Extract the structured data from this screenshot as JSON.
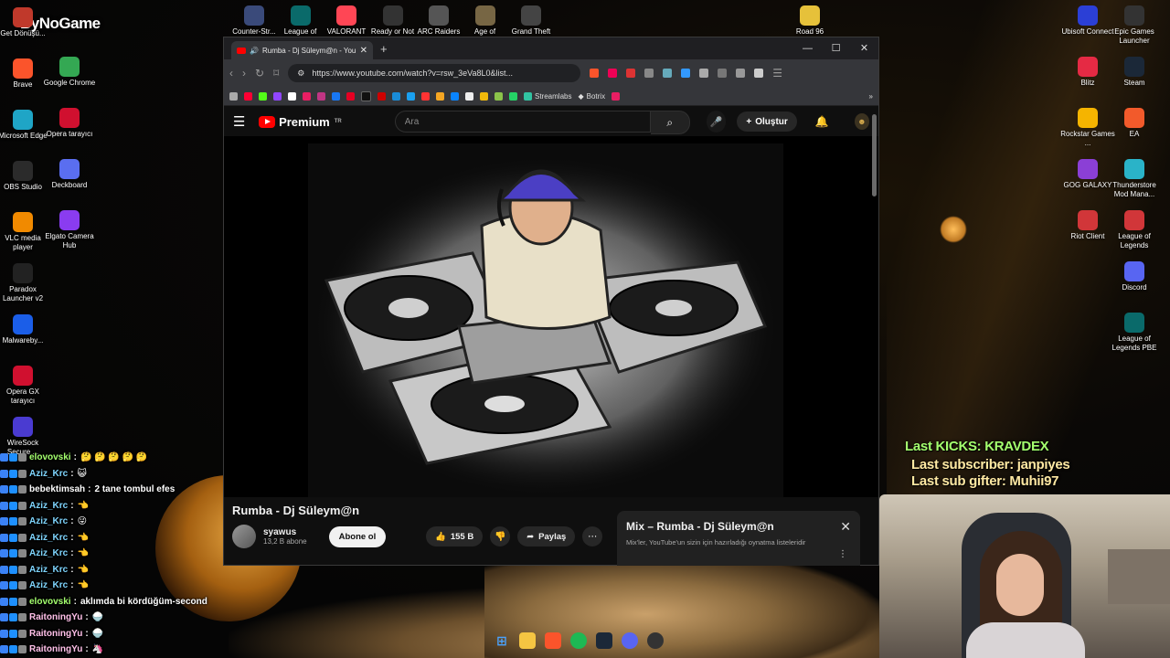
{
  "wallpaper": {
    "logo_text": "ByNoGame"
  },
  "desktop_left": [
    {
      "label": "Get Dönüşü...",
      "icon": "game-icon",
      "color": "#c0392b"
    },
    {
      "label": "Brave",
      "icon": "brave-icon",
      "color": "#fb542b"
    },
    {
      "label": "Microsoft Edge",
      "icon": "edge-icon",
      "color": "#1fa5c6"
    },
    {
      "label": "OBS Studio",
      "icon": "obs-icon",
      "color": "#2b2b2b"
    },
    {
      "label": "VLC media player",
      "icon": "vlc-icon",
      "color": "#f18a00"
    },
    {
      "label": "Paradox Launcher v2",
      "icon": "paradox-icon",
      "color": "#222"
    },
    {
      "label": "Malwareby...",
      "icon": "malwarebytes-icon",
      "color": "#1b5ee8"
    },
    {
      "label": "Opera GX tarayıcı",
      "icon": "operagx-icon",
      "color": "#d0102f"
    },
    {
      "label": "WireSock Secure ...",
      "icon": "wiresock-icon",
      "color": "#4a3bd1"
    }
  ],
  "desktop_left2": [
    {
      "label": "Google Chrome",
      "icon": "chrome-icon",
      "color": "#34a853"
    },
    {
      "label": "Opera tarayıcı",
      "icon": "opera-icon",
      "color": "#d0102f"
    },
    {
      "label": "Deckboard",
      "icon": "deckboard-icon",
      "color": "#5a6ef0"
    },
    {
      "label": "Elgato Camera Hub",
      "icon": "elgato-icon",
      "color": "#8a3cf0"
    }
  ],
  "desktop_top": [
    {
      "label": "Counter-Str...",
      "icon": "cs-icon",
      "color": "#3a4a7a"
    },
    {
      "label": "League of",
      "icon": "lol-icon",
      "color": "#0a6a6a"
    },
    {
      "label": "VALORANT",
      "icon": "valorant-icon",
      "color": "#ff4655"
    },
    {
      "label": "Ready or Not",
      "icon": "readyornot-icon",
      "color": "#333"
    },
    {
      "label": "ARC Raiders",
      "icon": "arc-icon",
      "color": "#555"
    },
    {
      "label": "Age of",
      "icon": "ageof-icon",
      "color": "#776644"
    },
    {
      "label": "Grand Theft",
      "icon": "gta-icon",
      "color": "#444"
    },
    {
      "label": "Road 96",
      "icon": "road96-icon",
      "color": "#e6c13a"
    }
  ],
  "desktop_right_a": [
    {
      "label": "Ubisoft Connect",
      "icon": "ubisoft-icon",
      "color": "#2b3fd6"
    },
    {
      "label": "Blitz",
      "icon": "blitz-icon",
      "color": "#e52a44"
    },
    {
      "label": "Rockstar Games ...",
      "icon": "rockstar-icon",
      "color": "#f5b400"
    },
    {
      "label": "GOG GALAXY",
      "icon": "gog-icon",
      "color": "#8b3fd6"
    },
    {
      "label": "Riot Client",
      "icon": "riot-icon",
      "color": "#d13639"
    }
  ],
  "desktop_right_b": [
    {
      "label": "Epic Games Launcher",
      "icon": "epic-icon",
      "color": "#333"
    },
    {
      "label": "Steam",
      "icon": "steam-icon",
      "color": "#1b2838"
    },
    {
      "label": "EA",
      "icon": "ea-icon",
      "color": "#f25a2b"
    },
    {
      "label": "Thunderstore Mod Mana...",
      "icon": "thunderstore-icon",
      "color": "#2ab3c8"
    },
    {
      "label": "League of Legends",
      "icon": "lol-icon",
      "color": "#d13639"
    },
    {
      "label": "Discord",
      "icon": "discord-icon",
      "color": "#5865f2"
    },
    {
      "label": "League of Legends PBE",
      "icon": "lolpbe-icon",
      "color": "#0a6a6a"
    }
  ],
  "overlay": {
    "last_kicks": "Last KICKS: KRAVDEX",
    "last_subscriber": "Last subscriber: janpiyes",
    "last_sub_gifter": "Last sub gifter: Muhii97"
  },
  "chat": [
    {
      "user": "elovovski",
      "color": "#a4ff6e",
      "msg": "🤔 🤔 🤔 🤔 🤔"
    },
    {
      "user": "Aziz_Krc",
      "color": "#7fd6ff",
      "msg": "😺"
    },
    {
      "user": "bebektimsah",
      "color": "#ffffff",
      "msg": "2 tane tombul efes"
    },
    {
      "user": "Aziz_Krc",
      "color": "#7fd6ff",
      "msg": "👈"
    },
    {
      "user": "Aziz_Krc",
      "color": "#7fd6ff",
      "msg": "😜"
    },
    {
      "user": "Aziz_Krc",
      "color": "#7fd6ff",
      "msg": "👈"
    },
    {
      "user": "Aziz_Krc",
      "color": "#7fd6ff",
      "msg": "👈"
    },
    {
      "user": "Aziz_Krc",
      "color": "#7fd6ff",
      "msg": "👈"
    },
    {
      "user": "Aziz_Krc",
      "color": "#7fd6ff",
      "msg": "👈"
    },
    {
      "user": "elovovski",
      "color": "#a4ff6e",
      "msg": "aklımda bi kördüğüm-second"
    },
    {
      "user": "RaitoningYu",
      "color": "#ffc0e8",
      "msg": "🍚"
    },
    {
      "user": "RaitoningYu",
      "color": "#ffc0e8",
      "msg": "🍚"
    },
    {
      "user": "RaitoningYu",
      "color": "#ffc0e8",
      "msg": "🦄"
    }
  ],
  "browser": {
    "tab_title": "Rumba - Dj Süleym@n - You",
    "url": "https://www.youtube.com/watch?v=rsw_3eVa8L0&list...",
    "bookmarks": [
      {
        "label": "Streamlabs",
        "color": "#31c3a2"
      },
      {
        "label": "Botrix",
        "color": "#ffffff"
      }
    ]
  },
  "youtube": {
    "logo": "Premium",
    "region": "TR",
    "search_placeholder": "Ara",
    "create_label": "Oluştur",
    "video_title": "Rumba - Dj Süleym@n",
    "channel_name": "syawus",
    "channel_subs": "13,2 B abone",
    "subscribe_label": "Abone ol",
    "likes": "155 B",
    "share_label": "Paylaş",
    "mix_title": "Mix – Rumba - Dj Süleym@n",
    "mix_subtitle": "Mix'ler, YouTube'un sizin için hazırladığı oynatma listeleridir"
  }
}
